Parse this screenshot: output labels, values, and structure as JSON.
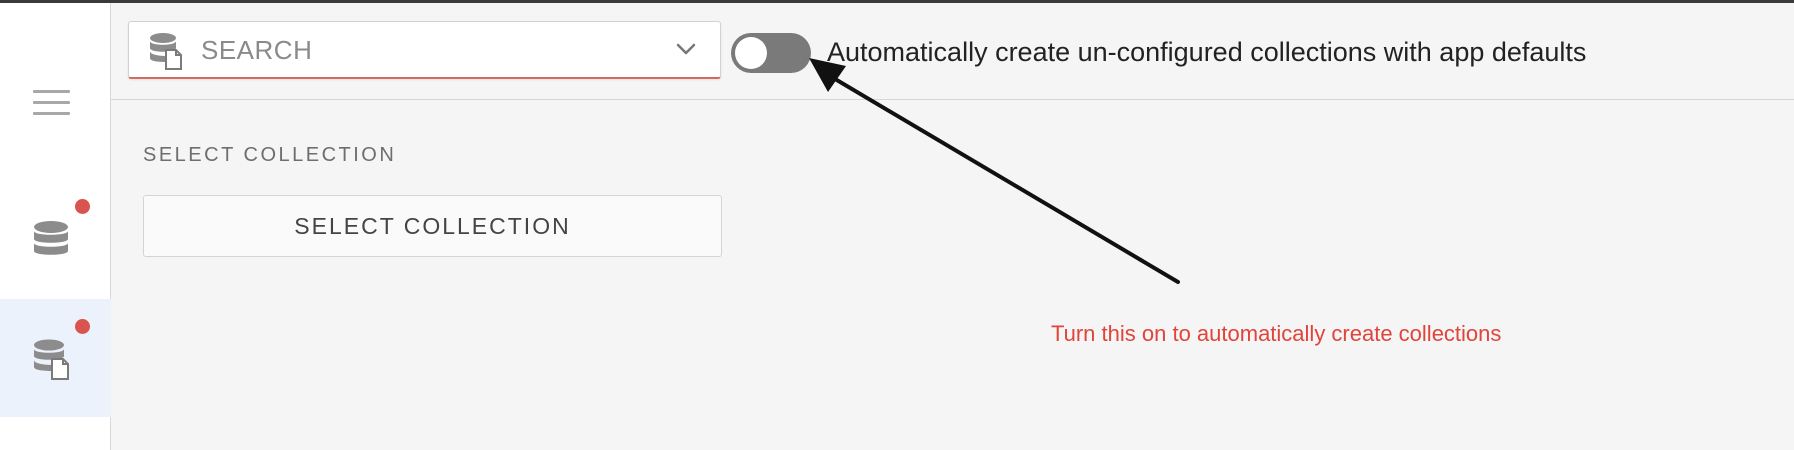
{
  "search": {
    "placeholder": "SEARCH",
    "value": ""
  },
  "sidebar": {
    "items": [
      {
        "name": "database",
        "icon": "database-icon",
        "has_badge": true
      },
      {
        "name": "collection",
        "icon": "database-document-icon",
        "has_badge": true,
        "active": true
      }
    ]
  },
  "toggle": {
    "label": "Automatically create un-configured collections with app defaults",
    "state": "off"
  },
  "main": {
    "section_label": "SELECT COLLECTION",
    "select_button_label": "SELECT COLLECTION"
  },
  "annotation": {
    "text": "Turn this on to automatically create collections"
  },
  "colors": {
    "accent_underline": "#d46a5a",
    "badge": "#d9534f",
    "toggle_off": "#7a7a7a",
    "annotation": "#e0443b",
    "active_nav_bg": "#ebf2fb"
  }
}
